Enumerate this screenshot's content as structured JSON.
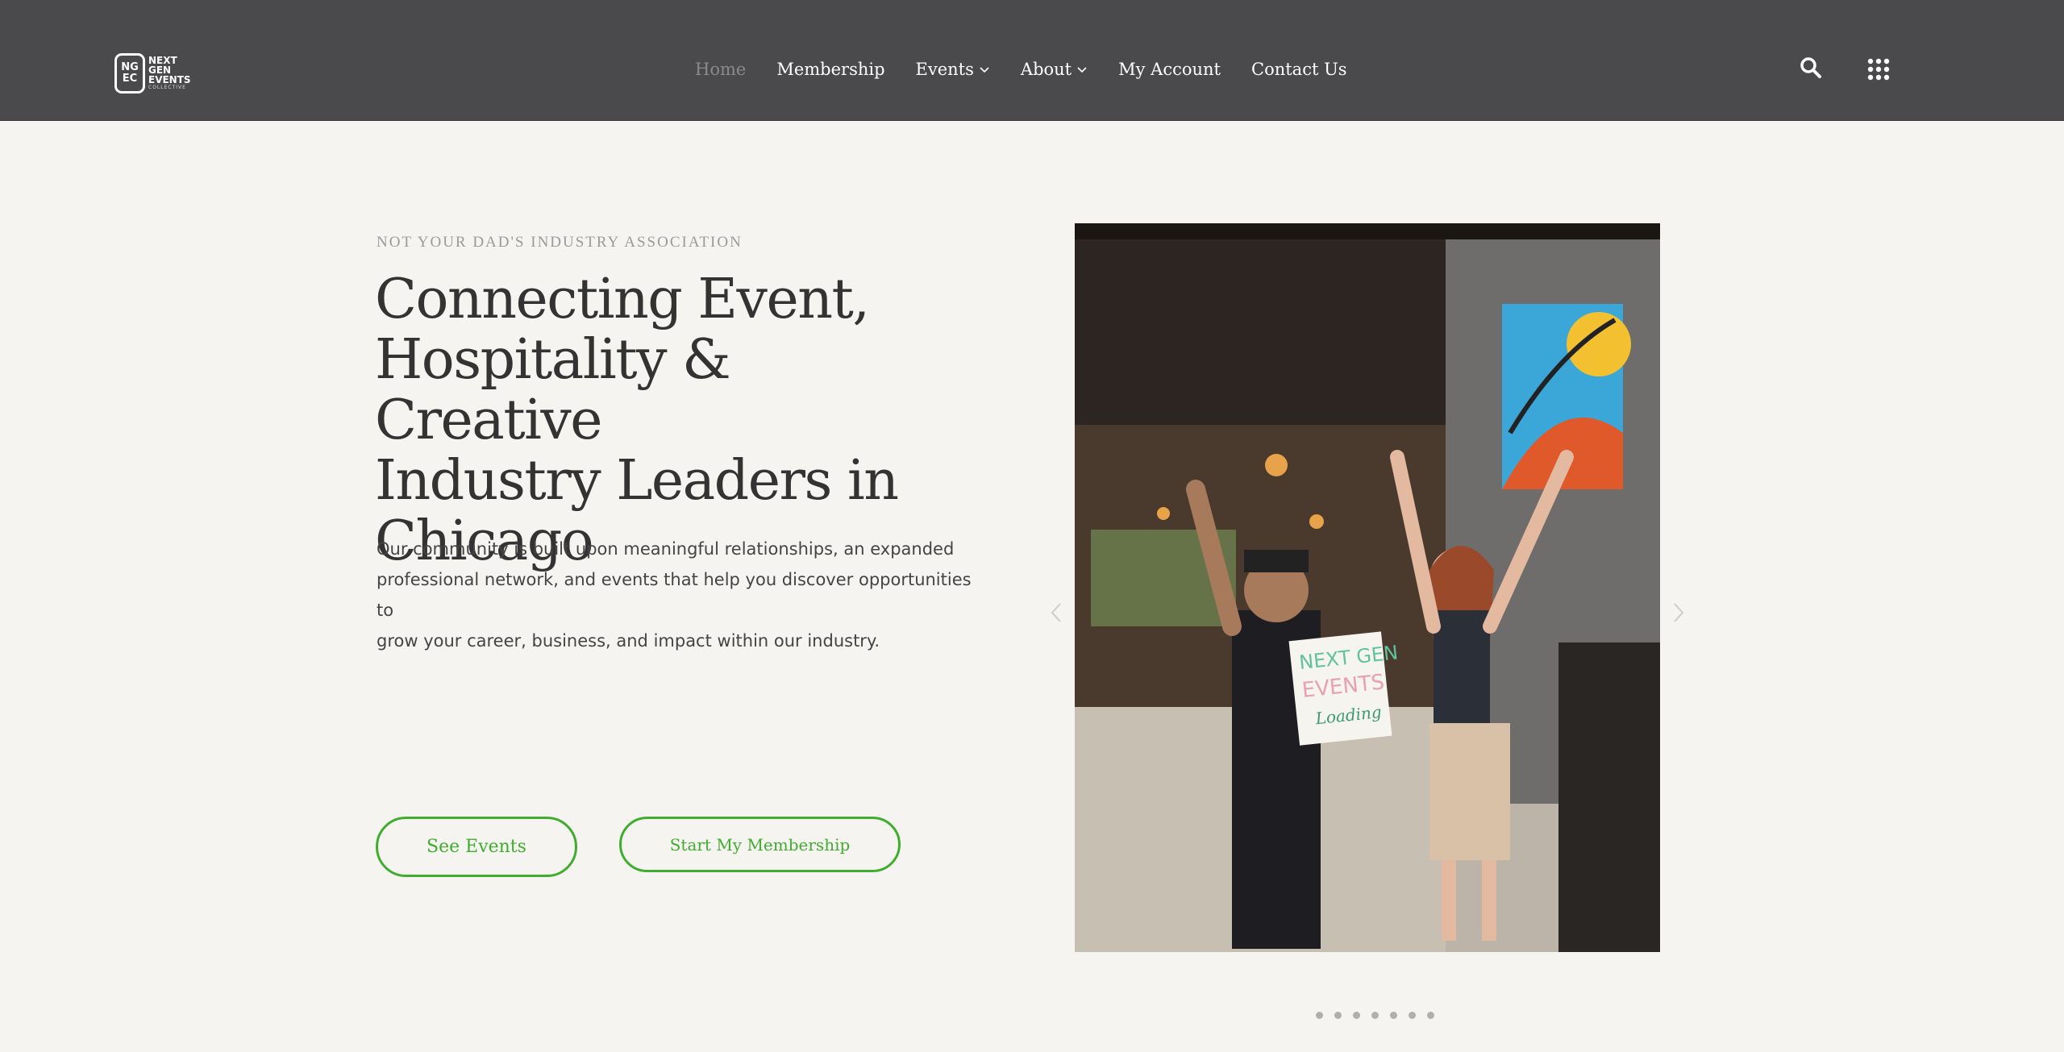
{
  "header": {
    "logo": {
      "mark_top": "NG",
      "mark_bottom": "EC",
      "line1": "NEXT",
      "line2": "GEN",
      "line3": "EVENTS",
      "line4": "COLLECTIVE"
    },
    "nav": [
      {
        "label": "Home",
        "active": true
      },
      {
        "label": "Membership"
      },
      {
        "label": "Events",
        "dropdown": true
      },
      {
        "label": "About",
        "dropdown": true
      },
      {
        "label": "My Account"
      },
      {
        "label": "Contact Us"
      }
    ],
    "icons": {
      "search": "search-icon",
      "menu": "grid-menu-icon"
    }
  },
  "hero": {
    "eyebrow": "NOT YOUR DAD'S INDUSTRY ASSOCIATION",
    "headline_lines": [
      "Connecting Event,",
      "Hospitality & Creative",
      "Industry Leaders in",
      "Chicago"
    ],
    "intro_lines": [
      "Our community is built upon meaningful relationships, an expanded",
      "professional network, and events that help you discover opportunities to",
      "grow your career, business, and impact within our industry."
    ],
    "buttons": {
      "events": "See Events",
      "membership": "Start My Membership"
    },
    "sign_text": {
      "line1": "NEXT GEN",
      "line2": "EVENTS",
      "line3": "Loading"
    }
  },
  "carousel": {
    "slide_count": 7,
    "active_index": 0
  },
  "colors": {
    "header_bg": "#4a4a4c",
    "page_bg": "#f5f4f0",
    "accent": "#3fae2e",
    "heading": "#333333"
  }
}
